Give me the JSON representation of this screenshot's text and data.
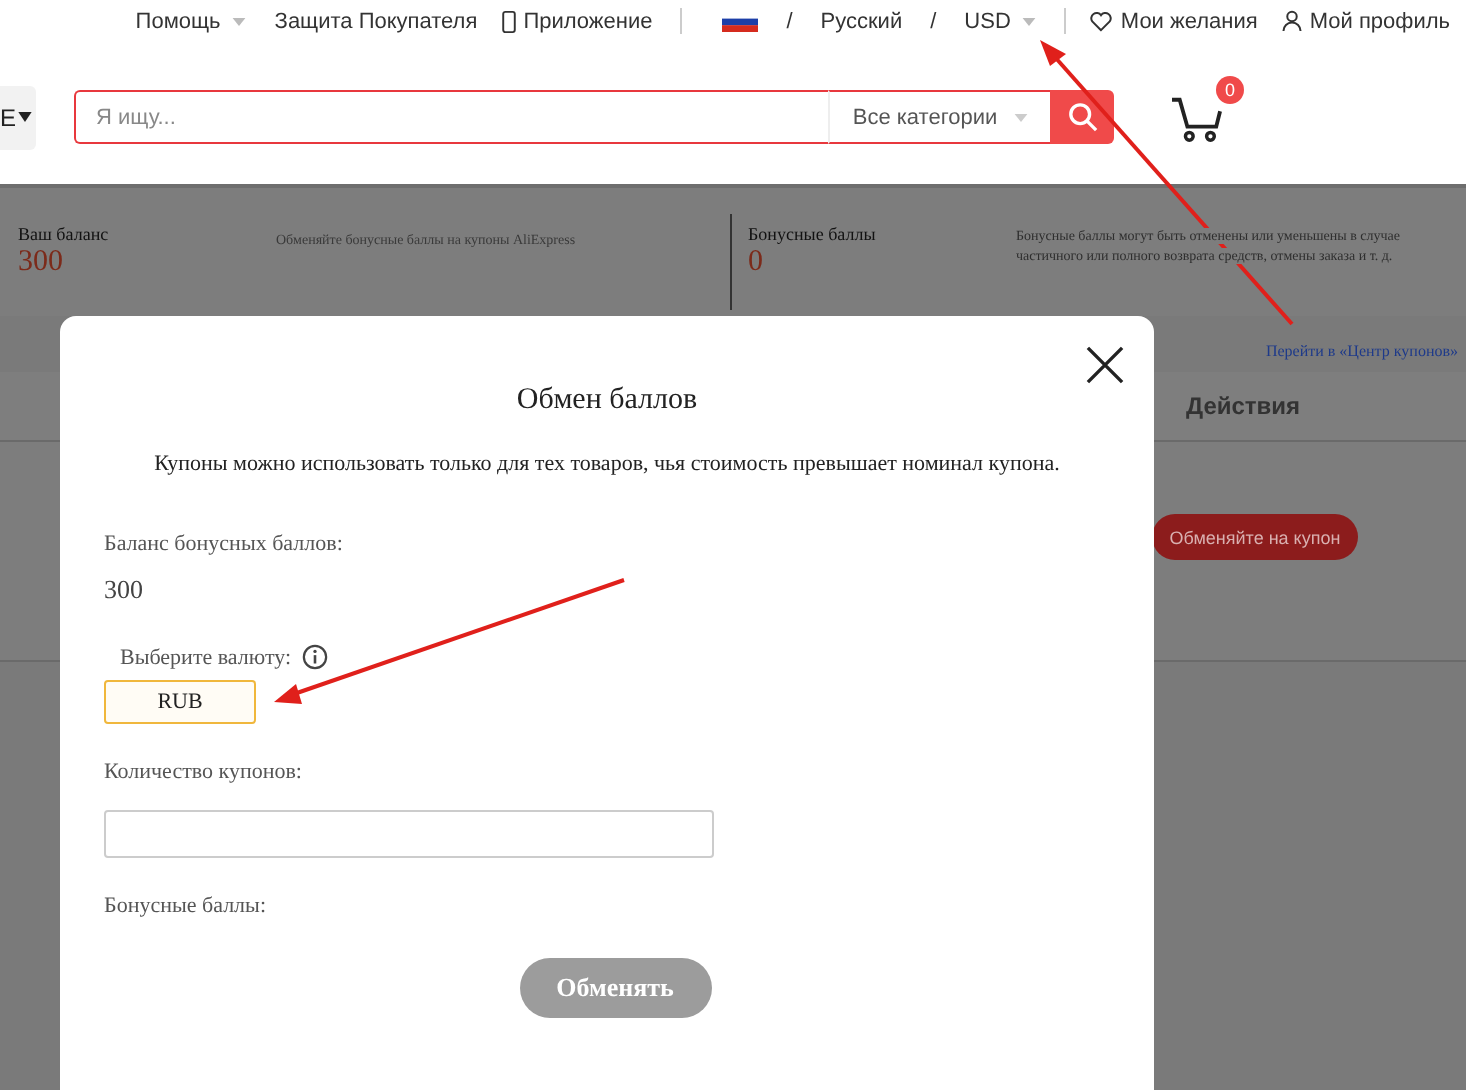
{
  "top_bar": {
    "help": "Помощь",
    "buyer_protection": "Защита Покупателя",
    "app": "Приложение",
    "sep1": "/",
    "language": "Русский",
    "sep2": "/",
    "currency": "USD",
    "wishlist": "Мои желания",
    "profile": "Мой профиль"
  },
  "header": {
    "category_button": "E",
    "search": {
      "placeholder": "Я ищу...",
      "category": "Все категории"
    },
    "cart_count": "0"
  },
  "balance": {
    "title": "Ваш баланс",
    "value": "300",
    "note": "Обменяйте бонусные баллы на купоны AliExpress"
  },
  "bonus": {
    "title": "Бонусные баллы",
    "value": "0",
    "note": [
      "Бонусные баллы могут быть отменены или уменьшены в случае",
      "частичного или полного возврата средств, отмены заказа и т. д."
    ]
  },
  "coupon_center_link": "Перейти в «Центр купонов»",
  "table": {
    "actions_header": "Действия",
    "row_button": "Обменяйте на купон"
  },
  "modal": {
    "title": "Обмен баллов",
    "notice": "Купоны можно использовать только для тех товаров, чья стоимость превышает номинал купона.",
    "balance_label": "Баланс бонусных баллов:",
    "balance_value": "300",
    "currency_label": "Выберите валюту:",
    "currency": "RUB",
    "quantity_label": "Количество купонов:",
    "bonus_label": "Бонусные баллы:",
    "submit": "Обменять",
    "submit_disabled": true
  }
}
